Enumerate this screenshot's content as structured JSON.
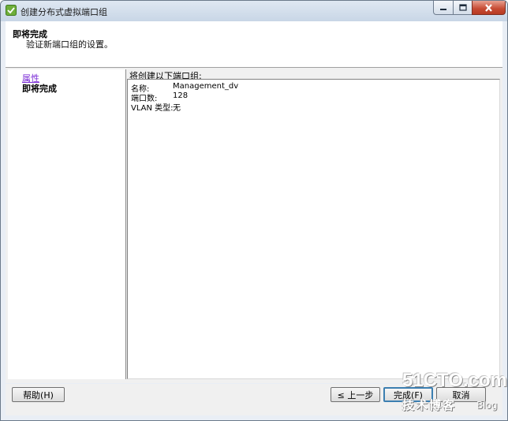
{
  "window": {
    "title": "创建分布式虚拟端口组"
  },
  "header": {
    "title": "即将完成",
    "subtitle": "验证新端口组的设置。"
  },
  "nav": {
    "items": [
      {
        "label": "属性",
        "state": "link"
      },
      {
        "label": "即将完成",
        "state": "current"
      }
    ]
  },
  "summary": {
    "heading": "将创建以下端口组:",
    "rows": [
      {
        "label": "名称:",
        "value": "Management_dv"
      },
      {
        "label": "端口数:",
        "value": "128"
      },
      {
        "label": "VLAN 类型:",
        "value": "无"
      }
    ]
  },
  "buttons": {
    "help": "帮助(H)",
    "back": "≤ 上一步",
    "finish": "完成(F)",
    "cancel": "取消"
  },
  "watermark": {
    "top": "51CTO.com",
    "bottom": "技术博客",
    "blog": "Blog"
  },
  "colors": {
    "link": "#7a2bd6",
    "close_button": "#c64a32",
    "default_button_border": "#3c7fb1",
    "window_frame": "#c8d6e6"
  },
  "icons": {
    "app": "vsphere-app-icon",
    "minimize": "minimize-icon",
    "maximize": "maximize-icon",
    "close": "close-icon"
  }
}
